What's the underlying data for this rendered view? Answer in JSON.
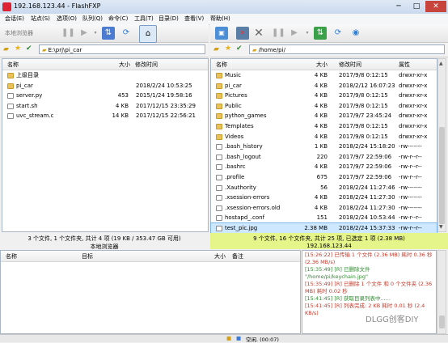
{
  "window": {
    "title": "192.168.123.44 - FlashFXP",
    "min": "─",
    "max": "□",
    "close": "✕"
  },
  "menu": [
    "会话(E)",
    "站点(S)",
    "选项(O)",
    "队列(Q)",
    "命令(C)",
    "工具(T)",
    "目录(D)",
    "查看(V)",
    "帮助(H)"
  ],
  "toolbar_left": {
    "local_browser_label": "本地浏览器"
  },
  "left": {
    "path": "E:\\prj\\pi_car",
    "headers": {
      "name": "名称",
      "size": "大小",
      "modified": "修改时间"
    },
    "rows": [
      {
        "type": "up",
        "name": "上级目录",
        "size": "",
        "modified": ""
      },
      {
        "type": "folder",
        "name": "pi_car",
        "size": "",
        "modified": "2018/2/24 10:53:25"
      },
      {
        "type": "file",
        "name": "server.py",
        "size": "453",
        "modified": "2015/1/24 19:58:16"
      },
      {
        "type": "file",
        "name": "start.sh",
        "size": "4 KB",
        "modified": "2017/12/15 23:35:29"
      },
      {
        "type": "file",
        "name": "uvc_stream.c",
        "size": "14 KB",
        "modified": "2017/12/15 22:56:21"
      }
    ],
    "status": "3 个文件, 1 个文件夹, 共计 4 项 (19 KB / 353.47 GB 可用)",
    "status_sub": "本地浏览器"
  },
  "right": {
    "path": "/home/pi/",
    "headers": {
      "name": "名称",
      "size": "大小",
      "modified": "修改时间",
      "attr": "属性"
    },
    "rows": [
      {
        "type": "folder",
        "name": "Music",
        "size": "4 KB",
        "modified": "2017/9/8 0:12:15",
        "attr": "drwxr-xr-x"
      },
      {
        "type": "folder",
        "name": "pi_car",
        "size": "4 KB",
        "modified": "2018/2/12 16:07:23",
        "attr": "drwxr-xr-x"
      },
      {
        "type": "folder",
        "name": "Pictures",
        "size": "4 KB",
        "modified": "2017/9/8 0:12:15",
        "attr": "drwxr-xr-x"
      },
      {
        "type": "folder",
        "name": "Public",
        "size": "4 KB",
        "modified": "2017/9/8 0:12:15",
        "attr": "drwxr-xr-x"
      },
      {
        "type": "folder",
        "name": "python_games",
        "size": "4 KB",
        "modified": "2017/9/7 23:45:24",
        "attr": "drwxr-xr-x"
      },
      {
        "type": "folder",
        "name": "Templates",
        "size": "4 KB",
        "modified": "2017/9/8 0:12:15",
        "attr": "drwxr-xr-x"
      },
      {
        "type": "folder",
        "name": "Videos",
        "size": "4 KB",
        "modified": "2017/9/8 0:12:15",
        "attr": "drwxr-xr-x"
      },
      {
        "type": "file",
        "name": ".bash_history",
        "size": "1 KB",
        "modified": "2018/2/24 15:18:20",
        "attr": "-rw-------"
      },
      {
        "type": "file",
        "name": ".bash_logout",
        "size": "220",
        "modified": "2017/9/7 22:59:06",
        "attr": "-rw-r--r--"
      },
      {
        "type": "file",
        "name": ".bashrc",
        "size": "4 KB",
        "modified": "2017/9/7 22:59:06",
        "attr": "-rw-r--r--"
      },
      {
        "type": "file",
        "name": ".profile",
        "size": "675",
        "modified": "2017/9/7 22:59:06",
        "attr": "-rw-r--r--"
      },
      {
        "type": "file",
        "name": ".Xauthority",
        "size": "56",
        "modified": "2018/2/24 11:27:46",
        "attr": "-rw-------"
      },
      {
        "type": "file",
        "name": ".xsession-errors",
        "size": "4 KB",
        "modified": "2018/2/24 11:27:30",
        "attr": "-rw-------"
      },
      {
        "type": "file",
        "name": ".xsession-errors.old",
        "size": "4 KB",
        "modified": "2018/2/24 11:27:30",
        "attr": "-rw-------"
      },
      {
        "type": "file",
        "name": "hostapd_.conf",
        "size": "151",
        "modified": "2018/2/24 10:53:44",
        "attr": "-rw-r--r--"
      },
      {
        "type": "file",
        "name": "test_pic.jpg",
        "size": "2.38 MB",
        "modified": "2018/2/24 15:37:33",
        "attr": "-rw-r--r--",
        "selected": true
      }
    ],
    "status": "9 个文件, 16 个文件夹, 共计 25 项, 已选定 1 项 (2.38 MB)",
    "status_sub": "192.168.123.44"
  },
  "queue": {
    "headers": {
      "name": "名称",
      "target": "目标",
      "size": "大小",
      "note": "备注"
    }
  },
  "log": [
    {
      "text": "[15:26:22] 已传输 1 个文件 (2.36 MB) 耗时 0.36 秒 (2.36 MB/s)",
      "color": "#c0392b"
    },
    {
      "text": "[15:35:49] [R] 已删除文件 \"/home/pi/keychain.jpg\"",
      "color": "#2e8b2e"
    },
    {
      "text": "[15:35:49] [R] 已删除 1 个文件 和 0 个文件夹 (2.36 MB) 耗时 0.02 秒",
      "color": "#c0392b"
    },
    {
      "text": "[15:41:45] [R] 获取目录列表中......",
      "color": "#2e8b2e"
    },
    {
      "text": "[15:41:45] [R] 列表完成: 2 KB 耗时 0.01 秒 (2.4 KB/s)",
      "color": "#c0392b"
    }
  ],
  "statusbar": {
    "idle": "空闲. (00:07)"
  },
  "watermark": "DLGG创客DIY"
}
